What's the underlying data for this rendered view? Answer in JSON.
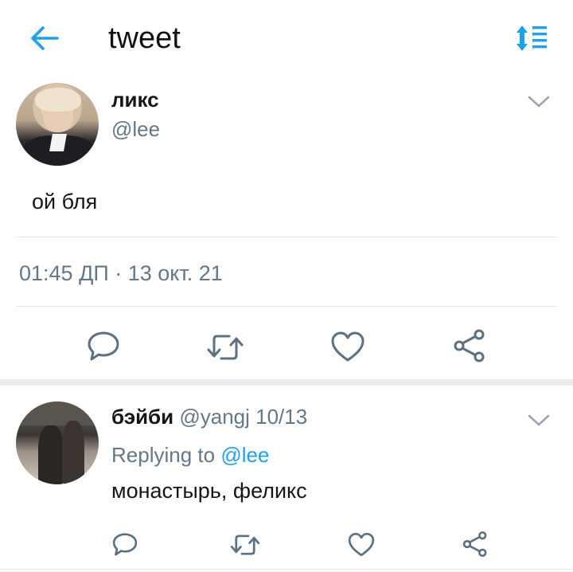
{
  "header": {
    "title": "tweet",
    "back_icon": "arrow-left-icon",
    "sort_icon": "sort-list-icon",
    "accent": "#1da1f2"
  },
  "tweet": {
    "name": "ликс",
    "handle": "@lee",
    "text": "ой бля",
    "timestamp": "01:45 ДП · 13 окт. 21",
    "actions": [
      "reply-icon",
      "retweet-icon",
      "like-icon",
      "share-icon"
    ]
  },
  "reply": {
    "name": "бэйби",
    "meta": "@yangj 10/13",
    "replying_prefix": "Replying to",
    "replying_mention": "@lee",
    "text": "монастырь, феликс",
    "actions": [
      "reply-icon",
      "retweet-icon",
      "like-icon",
      "share-icon"
    ]
  },
  "colors": {
    "text": "#14171a",
    "secondary": "#657786",
    "divider": "#e1e8ed",
    "icon": "#5b7083"
  }
}
